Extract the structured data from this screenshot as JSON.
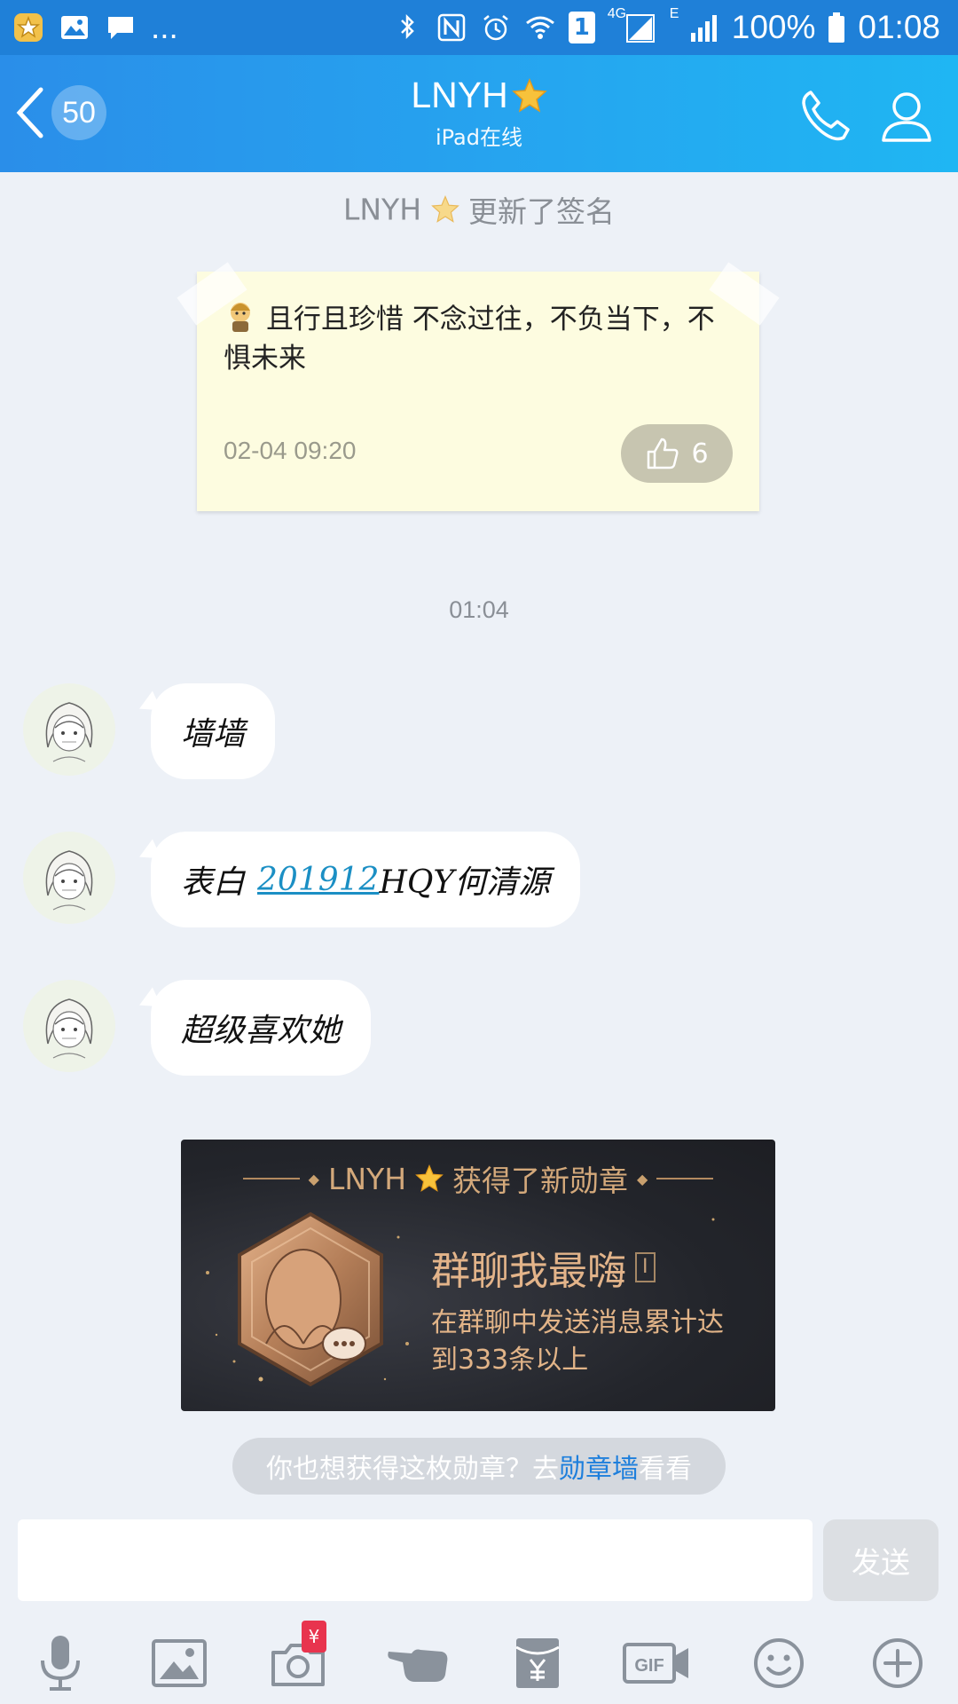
{
  "status_bar": {
    "left_icons": [
      "star-app-icon",
      "gallery-icon",
      "message-icon"
    ],
    "more": "...",
    "right_icons": [
      "bluetooth-icon",
      "nfc-icon",
      "alarm-icon",
      "wifi-icon",
      "sim1-icon",
      "signal-4g-icon",
      "signal-e-icon"
    ],
    "sim_label": "1",
    "net_4g": "4G",
    "net_e": "E",
    "battery": "100%",
    "time": "01:08"
  },
  "title_bar": {
    "back_count": "50",
    "name": "LNYH",
    "subtitle": "iPad在线"
  },
  "system_note": {
    "name": "LNYH",
    "text": "更新了签名"
  },
  "signature_card": {
    "text": "且行且珍惜 不念过往，不负当下，不惧未来",
    "date": "02-04 09:20",
    "likes": "6"
  },
  "time_separator": "01:04",
  "messages": [
    {
      "parts": [
        {
          "text": "墙墙",
          "link": false
        }
      ]
    },
    {
      "parts": [
        {
          "text": "表白",
          "link": false
        },
        {
          "text": "201912",
          "link": true
        },
        {
          "text": "HQY何清源",
          "link": false
        }
      ]
    },
    {
      "parts": [
        {
          "text": "超级喜欢她",
          "link": false
        }
      ]
    }
  ],
  "medal": {
    "header_name": "LNYH",
    "header_text": "获得了新勋章",
    "name": "群聊我最嗨",
    "level": "I",
    "desc": "在群聊中发送消息累计达到333条以上"
  },
  "tip": {
    "prefix": "你也想获得这枚勋章？去",
    "link": "勋章墙",
    "suffix": "看看"
  },
  "input": {
    "value": "",
    "send_label": "发送"
  },
  "toolbar": {
    "items": [
      "mic-icon",
      "image-icon",
      "camera-icon",
      "poke-icon",
      "red-packet-icon",
      "gif-icon",
      "emoji-icon",
      "plus-icon"
    ],
    "camera_badge": "¥",
    "gif_label": "GIF"
  },
  "colors": {
    "accent": "#2a8ee9",
    "link": "#1b8fc4",
    "medal_gold": "#e3b48a"
  }
}
